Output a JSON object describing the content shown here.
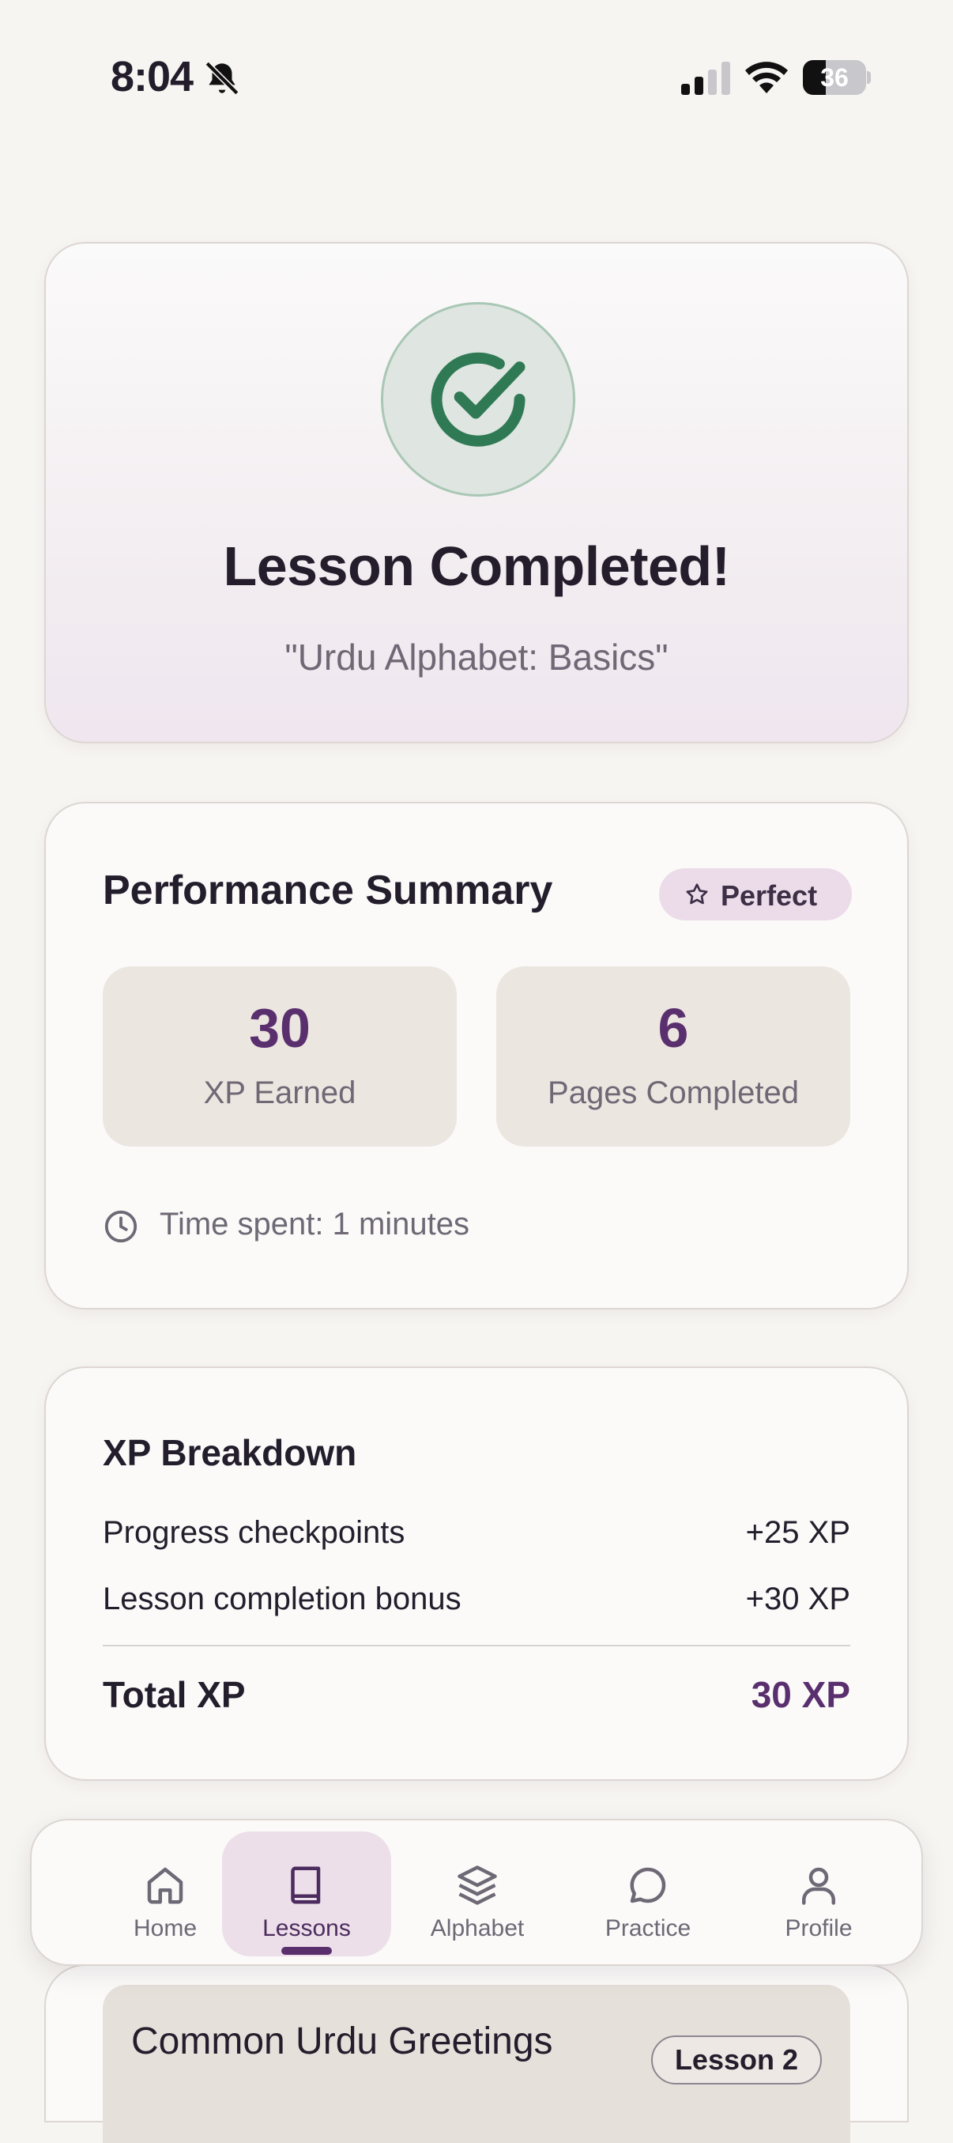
{
  "status_bar": {
    "time": "8:04",
    "battery_level": "36",
    "battery_fraction": 0.36
  },
  "completion": {
    "title": "Lesson Completed!",
    "lesson_name": "\"Urdu Alphabet: Basics\""
  },
  "performance": {
    "heading": "Performance Summary",
    "badge": "Perfect",
    "stats": [
      {
        "value": "30",
        "label": "XP Earned"
      },
      {
        "value": "6",
        "label": "Pages Completed"
      }
    ],
    "time_spent": "Time spent: 1 minutes"
  },
  "xp_breakdown": {
    "heading": "XP Breakdown",
    "rows": [
      {
        "label": "Progress checkpoints",
        "amount": "+25 XP"
      },
      {
        "label": "Lesson completion bonus",
        "amount": "+30 XP"
      }
    ],
    "total_label": "Total XP",
    "total_amount": "30 XP"
  },
  "next_lesson": {
    "title": "Common Urdu Greetings",
    "badge": "Lesson 2"
  },
  "tabs": [
    {
      "label": "Home",
      "icon": "home-icon"
    },
    {
      "label": "Lessons",
      "icon": "book-icon",
      "active": true
    },
    {
      "label": "Alphabet",
      "icon": "layers-icon"
    },
    {
      "label": "Practice",
      "icon": "chat-bubble-icon"
    },
    {
      "label": "Profile",
      "icon": "user-icon"
    }
  ],
  "colors": {
    "accent": "#5a2f6e",
    "success": "#2f7a55",
    "background": "#f7f5f2"
  }
}
